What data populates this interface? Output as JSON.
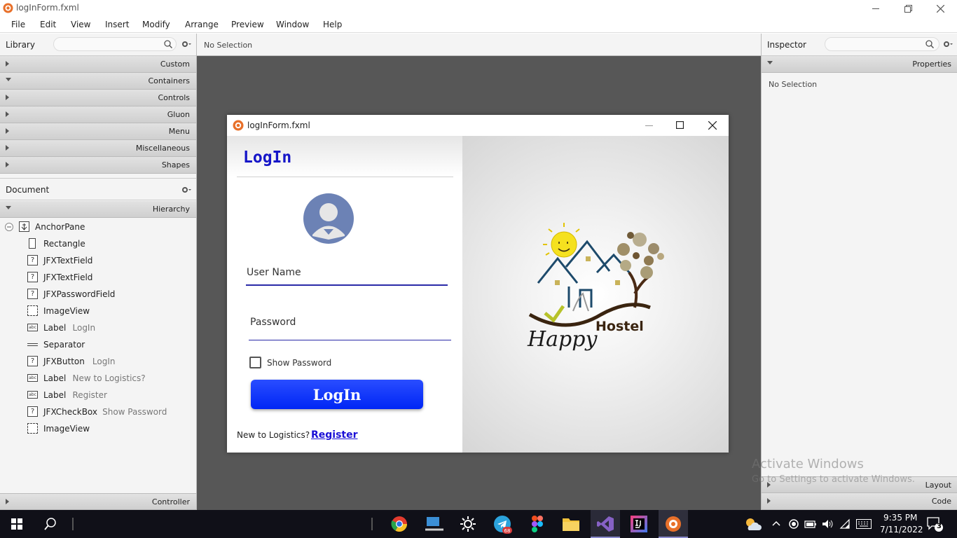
{
  "app": {
    "title": "logInForm.fxml"
  },
  "menu": [
    "File",
    "Edit",
    "View",
    "Insert",
    "Modify",
    "Arrange",
    "Preview",
    "Window",
    "Help"
  ],
  "library": {
    "title": "Library",
    "sections": [
      {
        "label": "Custom",
        "open": false
      },
      {
        "label": "Containers",
        "open": true
      },
      {
        "label": "Controls",
        "open": false
      },
      {
        "label": "Gluon",
        "open": false
      },
      {
        "label": "Menu",
        "open": false
      },
      {
        "label": "Miscellaneous",
        "open": false
      },
      {
        "label": "Shapes",
        "open": false
      }
    ]
  },
  "document": {
    "title": "Document",
    "hierarchy_label": "Hierarchy",
    "root": "AnchorPane",
    "items": [
      {
        "icon": "rect",
        "name": "Rectangle",
        "sub": ""
      },
      {
        "icon": "?",
        "name": "JFXTextField",
        "sub": ""
      },
      {
        "icon": "?",
        "name": "JFXTextField",
        "sub": ""
      },
      {
        "icon": "?",
        "name": "JFXPasswordField",
        "sub": ""
      },
      {
        "icon": "img",
        "name": "ImageView",
        "sub": ""
      },
      {
        "icon": "abc",
        "name": "Label",
        "sub": "LogIn"
      },
      {
        "icon": "sep",
        "name": "Separator",
        "sub": ""
      },
      {
        "icon": "?",
        "name": "JFXButton",
        "sub": "LogIn"
      },
      {
        "icon": "abc",
        "name": "Label",
        "sub": "New to Logistics?"
      },
      {
        "icon": "abc",
        "name": "Label",
        "sub": "Register"
      },
      {
        "icon": "?",
        "name": "JFXCheckBox",
        "sub": "Show Password"
      },
      {
        "icon": "img",
        "name": "ImageView",
        "sub": ""
      }
    ],
    "controller_label": "Controller"
  },
  "canvas": {
    "selection": "No Selection"
  },
  "preview": {
    "title": "logInForm.fxml",
    "heading": "LogIn",
    "username_placeholder": "User Name",
    "password_placeholder": "Password",
    "show_password_label": "Show Password",
    "show_password_checked": false,
    "login_button": "LogIn",
    "new_to_label": "New to Logistics?",
    "register_link": "Register",
    "logo_text_script": "Happy",
    "logo_text": "Hostel"
  },
  "inspector": {
    "title": "Inspector",
    "properties_label": "Properties",
    "selection": "No Selection",
    "layout_label": "Layout",
    "code_label": "Code"
  },
  "watermark": {
    "line1": "Activate Windows",
    "line2": "Go to Settings to activate Windows."
  },
  "taskbar": {
    "time": "9:35 PM",
    "date": "7/11/2022",
    "notification_count": "3",
    "telegram_badge": "68"
  },
  "colors": {
    "login_button": "#0033ff",
    "heading": "#1616c8",
    "link": "#1a0fd6",
    "underline_user": "#2a2aa8"
  }
}
